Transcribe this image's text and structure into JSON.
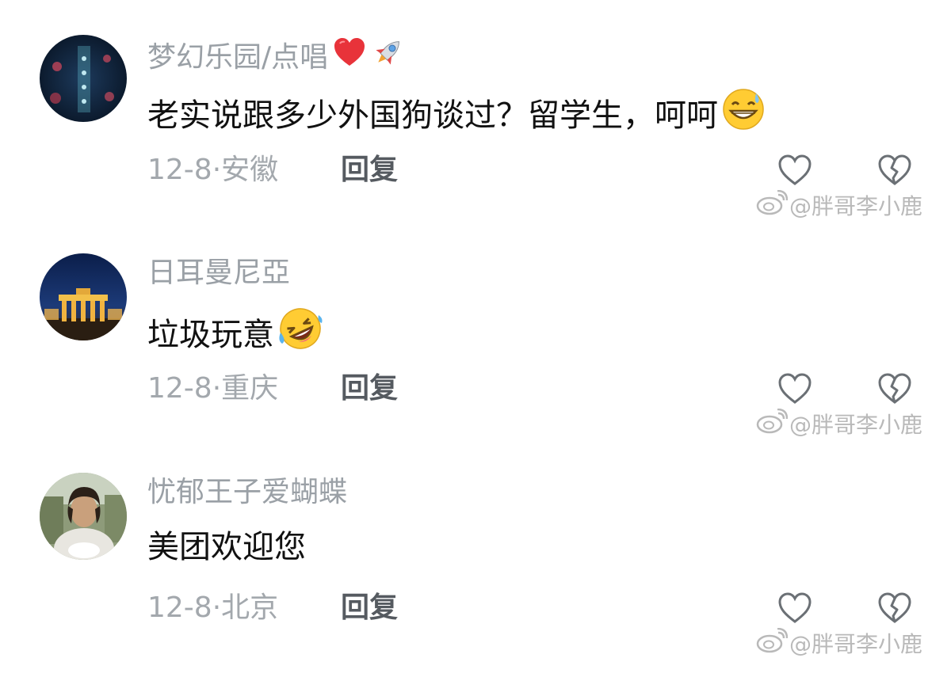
{
  "comments": [
    {
      "username": "梦幻乐园/点唱",
      "username_badges": [
        "red-heart-icon",
        "rocket-icon"
      ],
      "text": "老实说跟多少外国狗谈过？留学生，呵呵",
      "text_emoji": "grinning-sweat-emoji",
      "date": "12-8",
      "location": "安徽",
      "reply_label": "回复"
    },
    {
      "username": "日耳曼尼亞",
      "username_badges": [],
      "text": "垃圾玩意",
      "text_emoji": "rolling-laughing-emoji",
      "date": "12-8",
      "location": "重庆",
      "reply_label": "回复"
    },
    {
      "username": "忧郁王子爱蝴蝶",
      "username_badges": [],
      "text": "美团欢迎您",
      "text_emoji": "",
      "date": "12-8",
      "location": "北京",
      "reply_label": "回复"
    }
  ],
  "meta_separator": "·",
  "watermark": "@胖哥李小鹿",
  "colors": {
    "username": "#9aa0a6",
    "text": "#111111",
    "meta": "#a3a8ad",
    "reply": "#555a60",
    "icon": "#6b7075",
    "watermark": "#b9b9b9"
  }
}
